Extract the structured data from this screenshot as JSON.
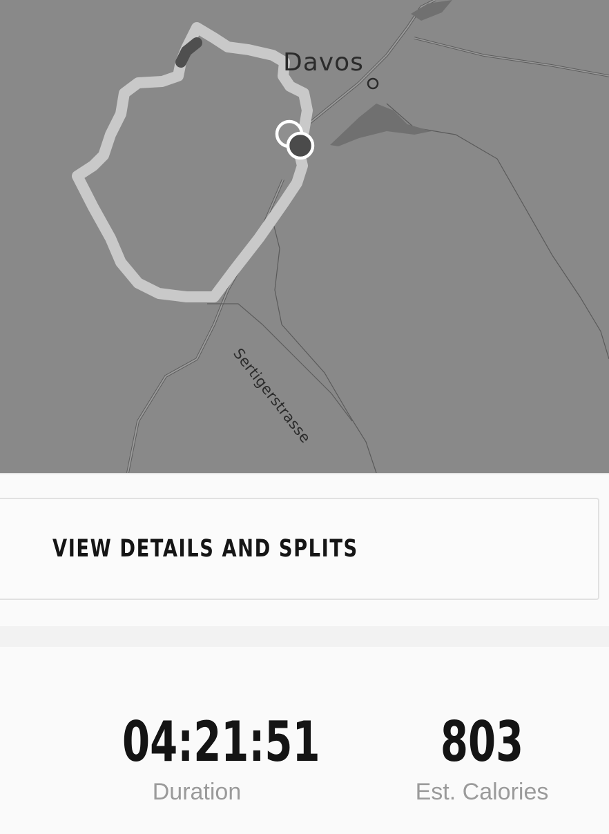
{
  "map": {
    "place_label": "Davos",
    "street_label": "Sertigerstrasse",
    "colors": {
      "background": "#898989",
      "route": "#c9c9c9",
      "lake": "#707070"
    },
    "markers": [
      "start-marker",
      "end-marker"
    ]
  },
  "details_button": {
    "label": "VIEW DETAILS AND SPLITS"
  },
  "stats": {
    "duration": {
      "value": "04:21:51",
      "label": "Duration"
    },
    "calories": {
      "value": "803",
      "label": "Est. Calories"
    }
  }
}
